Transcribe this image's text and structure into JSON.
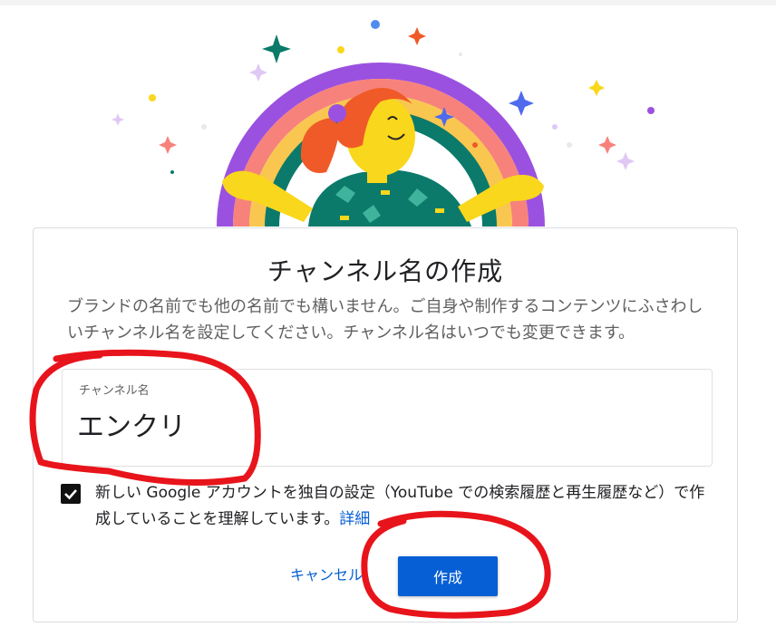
{
  "dialog": {
    "title": "チャンネル名の作成",
    "description": "ブランドの名前でも他の名前でも構いません。ご自身や制作するコンテンツにふさわしいチャンネル名を設定してください。チャンネル名はいつでも変更できます。",
    "channel_name_label": "チャンネル名",
    "channel_name_value": "エンクリ",
    "consent_text": "新しい Google アカウントを独自の設定（YouTube での検索履歴と再生履歴など）で作成していることを理解しています。",
    "consent_link": "詳細",
    "consent_checked": true,
    "cancel_label": "キャンセル",
    "create_label": "作成"
  },
  "colors": {
    "accent": "#065fd4",
    "annotation": "#e8141b"
  },
  "icons": {
    "checkbox": "checkmark-icon",
    "illustration": "rainbow-person-illustration"
  }
}
